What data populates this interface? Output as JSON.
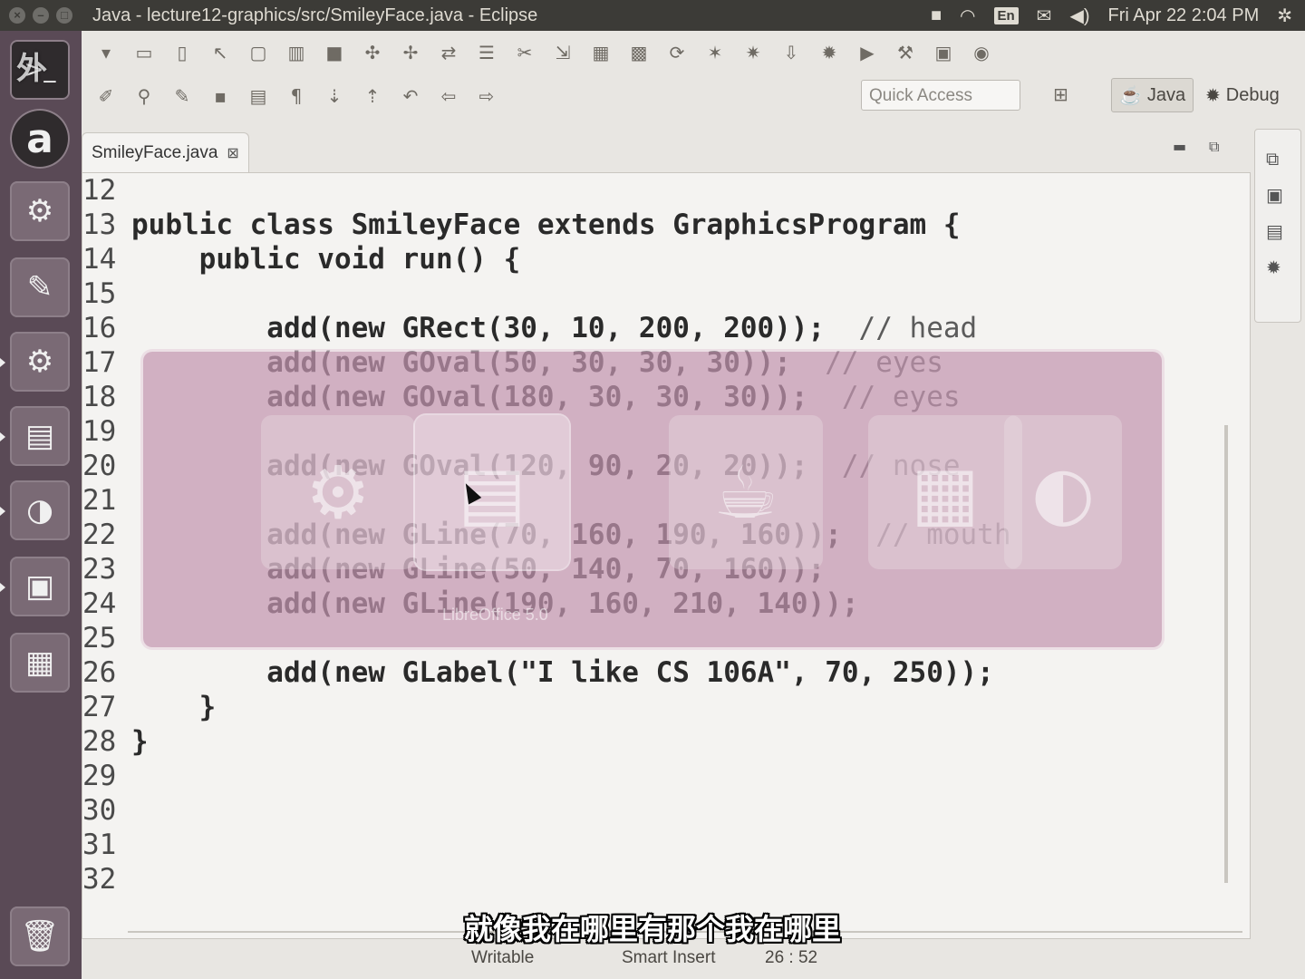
{
  "topbar": {
    "title": "Java - lecture12-graphics/src/SmileyFace.java - Eclipse",
    "input_indicator": "En",
    "datetime": "Fri Apr 22  2:04 PM"
  },
  "toolbar": {
    "quick_access_placeholder": "Quick Access",
    "perspective_java": "Java",
    "perspective_debug": "Debug"
  },
  "editor": {
    "tab_label": "SmileyFace.java",
    "tab_close": "⊠",
    "lines": [
      {
        "num": "12",
        "code": "",
        "comment": ""
      },
      {
        "num": "13",
        "code": "public class SmileyFace extends GraphicsProgram {",
        "comment": ""
      },
      {
        "num": "14",
        "code": "    public void run() {",
        "comment": ""
      },
      {
        "num": "15",
        "code": "",
        "comment": ""
      },
      {
        "num": "16",
        "code": "        add(new GRect(30, 10, 200, 200));  ",
        "comment": "// head"
      },
      {
        "num": "17",
        "code": "        add(new GOval(50, 30, 30, 30));  ",
        "comment": "// eyes"
      },
      {
        "num": "18",
        "code": "        add(new GOval(180, 30, 30, 30));  ",
        "comment": "// eyes"
      },
      {
        "num": "19",
        "code": "",
        "comment": ""
      },
      {
        "num": "20",
        "code": "        add(new GOval(120, 90, 20, 20));  ",
        "comment": "// nose"
      },
      {
        "num": "21",
        "code": "",
        "comment": ""
      },
      {
        "num": "22",
        "code": "        add(new GLine(70, 160, 190, 160));  ",
        "comment": "// mouth"
      },
      {
        "num": "23",
        "code": "        add(new GLine(50, 140, 70, 160));",
        "comment": ""
      },
      {
        "num": "24",
        "code": "        add(new GLine(190, 160, 210, 140));",
        "comment": ""
      },
      {
        "num": "25",
        "code": "",
        "comment": ""
      },
      {
        "num": "26",
        "code": "        add(new GLabel(\"I like CS 106A\", 70, 250));",
        "comment": ""
      },
      {
        "num": "27",
        "code": "    }",
        "comment": ""
      },
      {
        "num": "28",
        "code": "}",
        "comment": ""
      },
      {
        "num": "29",
        "code": "",
        "comment": ""
      },
      {
        "num": "30",
        "code": "",
        "comment": ""
      },
      {
        "num": "31",
        "code": "",
        "comment": ""
      },
      {
        "num": "32",
        "code": "",
        "comment": ""
      }
    ]
  },
  "switcher": {
    "items": [
      {
        "name": "ide",
        "icon": "⚙"
      },
      {
        "name": "libreoffice",
        "icon": "▤"
      },
      {
        "name": "java",
        "icon": "☕"
      },
      {
        "name": "impress",
        "icon": "▦"
      },
      {
        "name": "other",
        "icon": "◐"
      }
    ],
    "label": "LibreOffice 5.0"
  },
  "statusbar": {
    "writable": "Writable",
    "insert_mode": "Smart Insert",
    "position": "26 : 52"
  },
  "subtitle": "就像我在哪里有那个我在哪里",
  "watermark": "外"
}
